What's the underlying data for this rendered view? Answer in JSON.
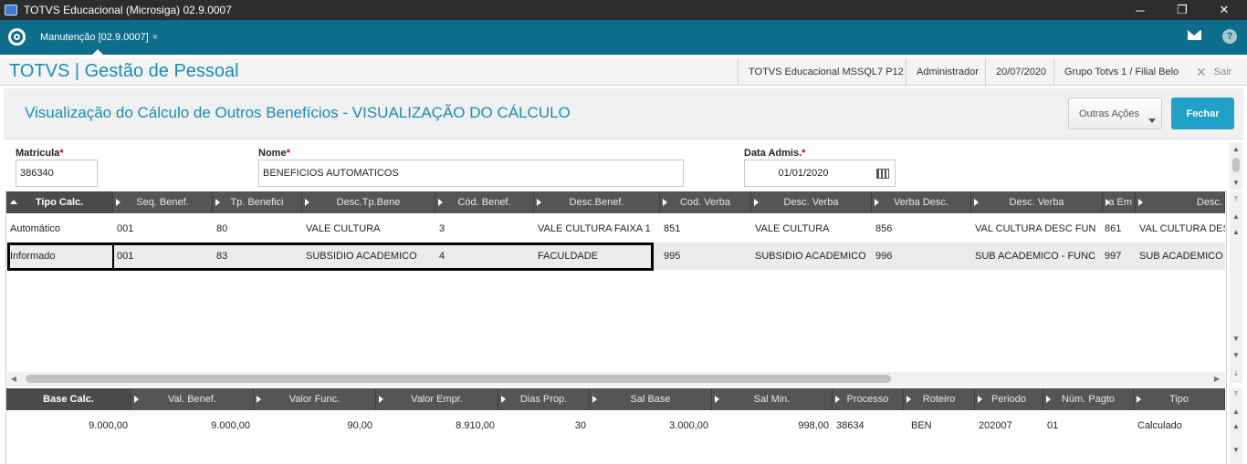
{
  "window": {
    "title": "TOTVS Educacional (Microsiga) 02.9.0007",
    "minimize": "─",
    "restore": "❐",
    "close": "✕"
  },
  "tabbar": {
    "tab_label": "Manutenção [02.9.0007]",
    "tab_close": "×",
    "help": "?"
  },
  "header": {
    "brand": "TOTVS | Gestão de Pessoal",
    "environment": "TOTVS Educacional MSSQL7 P12",
    "user": "Administrador",
    "date": "20/07/2020",
    "branch": "Grupo Totvs 1 / Filial Belo",
    "exit_label": "Sair",
    "exit_icon": "✕"
  },
  "page": {
    "title": "Visualização do Cálculo de Outros Benefícios - VISUALIZAÇÃO DO CÁLCULO",
    "outras_acoes": "Outras Ações",
    "fechar": "Fechar"
  },
  "form": {
    "matricula_label": "Matricula",
    "matricula_value": "386340",
    "nome_label": "Nome",
    "nome_value": "BENEFICIOS AUTOMATICOS",
    "data_label": "Data Admis.",
    "data_value": "01/01/2020",
    "required_mark": "*"
  },
  "grid1": {
    "columns": [
      "Tipo Calc.",
      "Seq. Benef.",
      "Tp. Benefici",
      "Desc.Tp.Bene",
      "Cód. Benef.",
      "Desc.Benef.",
      "Cod. Verba",
      "Desc. Verba",
      "Verba Desc.",
      "Desc. Verba",
      "a Em",
      "Desc."
    ],
    "rows": [
      [
        "Automático",
        "001",
        "80",
        "VALE CULTURA",
        "3",
        "VALE CULTURA FAIXA 1",
        "851",
        "VALE CULTURA",
        "856",
        "VAL CULTURA DESC FUN",
        "861",
        "VAL CULTURA DESC"
      ],
      [
        "Informado",
        "001",
        "83",
        "SUBSIDIO ACADEMICO",
        "4",
        "FACULDADE",
        "995",
        "SUBSIDIO ACADEMICO",
        "996",
        "SUB ACADEMICO - FUNC",
        "997",
        "SUB ACADEMICO -"
      ]
    ]
  },
  "grid2": {
    "columns": [
      "Base Calc.",
      "Val. Benef.",
      "Valor Func.",
      "Valor Empr.",
      "Dias Prop.",
      "Sal Base",
      "Sal Min.",
      "Processo",
      "Roteiro",
      "Periodo",
      "Núm. Pagto",
      "Tipo"
    ],
    "rows": [
      [
        "9.000,00",
        "9.000,00",
        "90,00",
        "8.910,00",
        "30",
        "3.000,00",
        "998,00",
        "38634",
        "BEN",
        "202007",
        "01",
        "Calculado"
      ]
    ]
  },
  "scroll": {
    "up": "▲",
    "down": "▼",
    "left": "◀",
    "right": "▶",
    "top": "⤒",
    "bottom": "⤓"
  }
}
